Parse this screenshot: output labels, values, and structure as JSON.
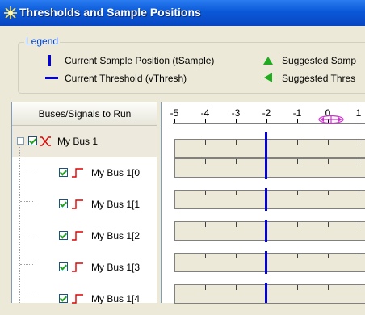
{
  "window": {
    "title": "Thresholds and Sample Positions"
  },
  "legend": {
    "title": "Legend",
    "items": [
      {
        "label": "Current Sample Position (tSample)",
        "icon": "vertical-bar-icon"
      },
      {
        "label": "Current Threshold (vThresh)",
        "icon": "horizontal-bar-icon"
      },
      {
        "label": "Suggested Samp",
        "icon": "up-triangle-icon",
        "color": "#22AA22"
      },
      {
        "label": "Suggested Thres",
        "icon": "left-triangle-icon",
        "color": "#22AA22"
      }
    ]
  },
  "tree": {
    "header": "Buses/Signals to Run",
    "root": {
      "label": "My Bus 1",
      "checked": true,
      "expanded": true
    },
    "children": [
      {
        "label": "My Bus 1[0",
        "checked": true
      },
      {
        "label": "My Bus 1[1",
        "checked": true
      },
      {
        "label": "My Bus 1[2",
        "checked": true
      },
      {
        "label": "My Bus 1[3",
        "checked": true
      },
      {
        "label": "My Bus 1[4",
        "checked": true
      }
    ]
  },
  "scale": {
    "ticks": [
      "-5",
      "-4",
      "-3",
      "-2",
      "-1",
      "0",
      "1"
    ]
  },
  "colors": {
    "threshold": "#0000E0",
    "signal_red": "#E00000",
    "accent": "#0046D5"
  }
}
